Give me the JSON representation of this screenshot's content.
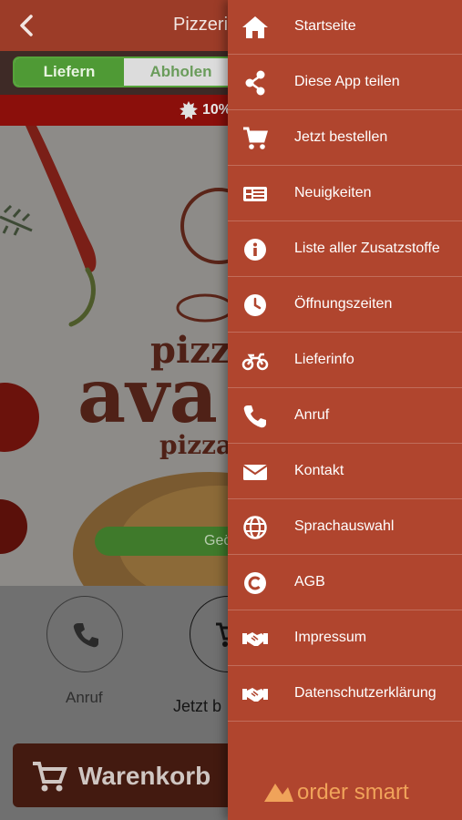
{
  "header": {
    "title": "Pizzeri"
  },
  "order_mode": {
    "options": [
      "Liefern",
      "Abholen"
    ],
    "selected": "Liefern"
  },
  "promo_banner": {
    "text": "10%"
  },
  "hero": {
    "logo_text_1": "pizz",
    "logo_text_2": "ava",
    "logo_text_3": "pizza",
    "geo_button": "Geö"
  },
  "actions": {
    "call_label": "Anruf",
    "order_label": "Jetzt b"
  },
  "cart": {
    "label": "Warenkorb"
  },
  "drawer": {
    "items": [
      {
        "label": "Startseite",
        "icon": "home-icon"
      },
      {
        "label": "Diese App teilen",
        "icon": "share-icon"
      },
      {
        "label": "Jetzt bestellen",
        "icon": "cart-icon"
      },
      {
        "label": "Neuigkeiten",
        "icon": "news-icon"
      },
      {
        "label": "Liste aller Zusatzstoffe",
        "icon": "info-icon"
      },
      {
        "label": "Öffnungszeiten",
        "icon": "clock-icon"
      },
      {
        "label": "Lieferinfo",
        "icon": "motorcycle-icon"
      },
      {
        "label": "Anruf",
        "icon": "phone-icon"
      },
      {
        "label": "Kontakt",
        "icon": "envelope-icon"
      },
      {
        "label": "Sprachauswahl",
        "icon": "globe-icon"
      },
      {
        "label": "AGB",
        "icon": "copyright-icon"
      },
      {
        "label": "Impressum",
        "icon": "handshake-icon"
      },
      {
        "label": "Datenschutzerklärung",
        "icon": "handshake-icon"
      }
    ],
    "brand": "order smart"
  },
  "colors": {
    "drawer_bg": "#b0452e",
    "header_bg": "#9c3c28",
    "accent_green": "#4f9a35",
    "banner_red": "#8b0f0b",
    "brand_orange": "#f0a35a"
  }
}
